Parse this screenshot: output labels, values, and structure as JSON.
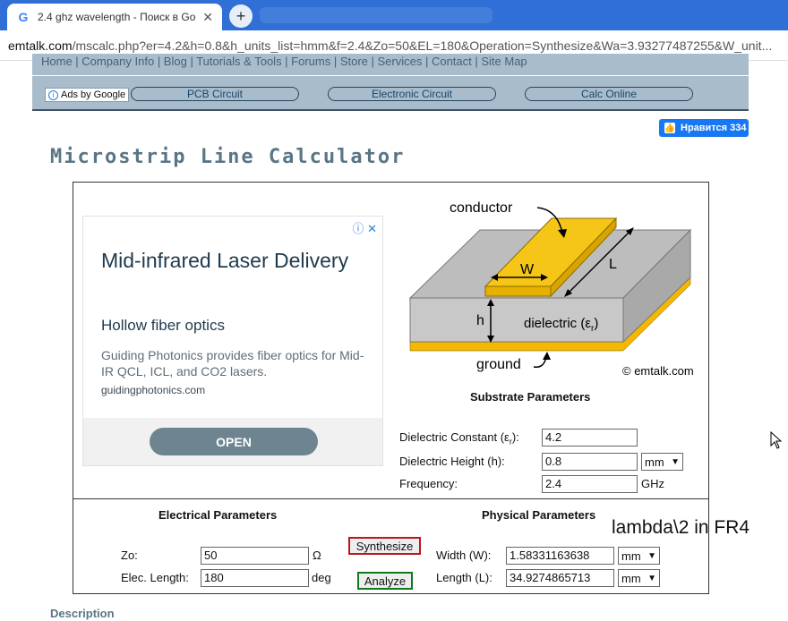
{
  "browser": {
    "tab_title": "2.4 ghz wavelength - Поиск в Go",
    "tab_close": "✕",
    "new_tab": "+",
    "url_host": "emtalk.com",
    "url_path": "/mscalc.php?er=4.2&h=0.8&h_units_list=hmm&f=2.4&Zo=50&EL=180&Operation=Synthesize&Wa=3.93277487255&W_unit..."
  },
  "site_nav": {
    "links": "Home | Company Info | Blog | Tutorials & Tools | Forums | Store | Services | Contact | Site Map"
  },
  "ads_row": {
    "ads_by": "Ads by Google",
    "pills": [
      "PCB Circuit",
      "Electronic Circuit",
      "Calc Online"
    ]
  },
  "facebook": {
    "label": "Нравится 334"
  },
  "page_title": "Microstrip Line Calculator",
  "ad": {
    "title": "Mid-infrared Laser Delivery",
    "subtitle": "Hollow fiber optics",
    "description": "Guiding Photonics provides fiber optics for Mid-IR QCL, ICL, and CO2 lasers.",
    "domain": "guidingphotonics.com",
    "button": "OPEN"
  },
  "diagram": {
    "conductor": "conductor",
    "w": "W",
    "l": "L",
    "h": "h",
    "dielectric": "dielectric (ε",
    "dielectric_sub": "r",
    "dielectric_end": ")",
    "ground": "ground",
    "copyright": "© emtalk.com"
  },
  "substrate": {
    "heading": "Substrate Parameters",
    "dielectric_constant_label": "Dielectric Constant (ε",
    "dielectric_constant_sub": "r",
    "dielectric_constant_end": "):",
    "dielectric_constant_value": "4.2",
    "height_label": "Dielectric Height (h):",
    "height_value": "0.8",
    "height_unit": "mm",
    "frequency_label": "Frequency:",
    "frequency_value": "2.4",
    "frequency_unit": "GHz"
  },
  "electrical": {
    "heading": "Electrical Parameters",
    "zo_label": "Zo:",
    "zo_value": "50",
    "zo_unit": "Ω",
    "elec_length_label": "Elec. Length:",
    "elec_length_value": "180",
    "elec_length_unit": "deg"
  },
  "actions": {
    "synthesize": "Synthesize",
    "analyze": "Analyze"
  },
  "physical": {
    "heading": "Physical Parameters",
    "width_label": "Width (W):",
    "width_value": "1.58331163638",
    "width_unit": "mm",
    "length_label": "Length (L):",
    "length_value": "34.9274865713",
    "length_unit": "mm"
  },
  "annotation": "lambda\\2 in FR4",
  "description_link": "Description",
  "colors": {
    "chrome": "#2f6fd6",
    "nav_bg": "#a8bccb",
    "conductor": "#f5c518",
    "dielectric": "#c8c8c8",
    "title": "#5a7586"
  }
}
